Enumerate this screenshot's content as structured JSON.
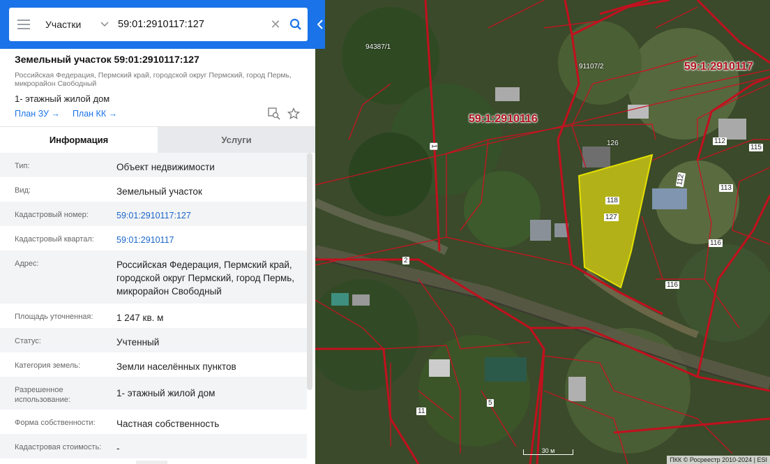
{
  "search": {
    "layer_label": "Участки",
    "value": "59:01:2910117:127"
  },
  "card": {
    "title": "Земельный участок 59:01:2910117:127",
    "address_sub": "Российская Федерация, Пермский край, городской округ Пермский, город Пермь, микрорайон Свободный",
    "purpose": "1- этажный жилой дом",
    "link_plan_zu": "План ЗУ →",
    "link_plan_kk": "План КК →"
  },
  "tabs": [
    {
      "label": "Информация",
      "active": true
    },
    {
      "label": "Услуги",
      "active": false
    }
  ],
  "info_rows": [
    {
      "label": "Тип:",
      "value": "Объект недвижимости",
      "link": false
    },
    {
      "label": "Вид:",
      "value": "Земельный участок",
      "link": false
    },
    {
      "label": "Кадастровый номер:",
      "value": "59:01:2910117:127",
      "link": true
    },
    {
      "label": "Кадастровый квартал:",
      "value": "59:01:2910117",
      "link": true
    },
    {
      "label": "Адрес:",
      "value": "Российская Федерация, Пермский край, городской округ Пермский, город Пермь, микрорайон Свободный",
      "link": false
    },
    {
      "label": "Площадь уточненная:",
      "value": "1 247 кв. м",
      "link": false
    },
    {
      "label": "Статус:",
      "value": "Учтенный",
      "link": false
    },
    {
      "label": "Категория земель:",
      "value": "Земли населённых пунктов",
      "link": false
    },
    {
      "label": "Разрешенное использование:",
      "value": "1- этажный жилой дом",
      "link": false
    },
    {
      "label": "Форма собственности:",
      "value": "Частная собственность",
      "link": false
    },
    {
      "label": "Кадастровая стоимость:",
      "value": "-",
      "link": false
    }
  ],
  "map": {
    "quarter_labels": [
      "59:1:2910117",
      "59:1:2910116"
    ],
    "parcel_labels": [
      "94387/1",
      "91107/2",
      "126",
      "118",
      "127",
      "112",
      "115",
      "113",
      "116",
      "116",
      "112",
      "1",
      "2",
      "11",
      "5"
    ],
    "scale_label": "30 м",
    "attribution": "ПКК © Росреестр 2010-2024 | ESI"
  },
  "colors": {
    "header_blue": "#1a73e8",
    "link_blue": "#1a66c9",
    "parcel_border": "#d01020",
    "selected_fill": "#f2ea10"
  }
}
